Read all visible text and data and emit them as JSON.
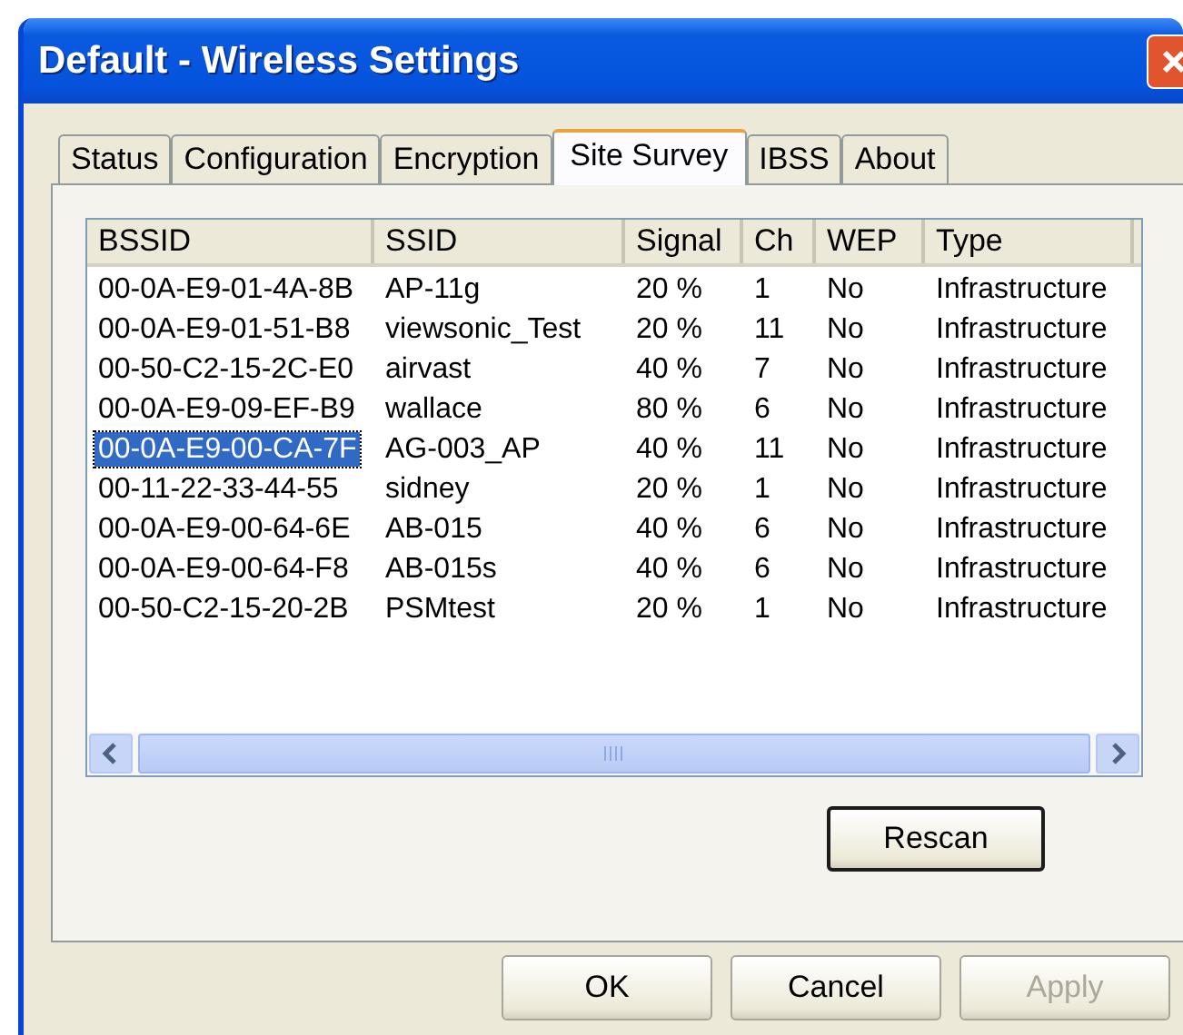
{
  "window": {
    "title": "Default - Wireless Settings"
  },
  "tabs": [
    {
      "label": "Status",
      "selected": false
    },
    {
      "label": "Configuration",
      "selected": false
    },
    {
      "label": "Encryption",
      "selected": false
    },
    {
      "label": "Site Survey",
      "selected": true
    },
    {
      "label": "IBSS",
      "selected": false
    },
    {
      "label": "About",
      "selected": false
    }
  ],
  "table": {
    "columns": [
      "BSSID",
      "SSID",
      "Signal",
      "Ch",
      "WEP",
      "Type"
    ],
    "rows": [
      {
        "cells": [
          "00-0A-E9-01-4A-8B",
          "AP-11g",
          "20 %",
          "1",
          "No",
          "Infrastructure"
        ],
        "selected": false
      },
      {
        "cells": [
          "00-0A-E9-01-51-B8",
          "viewsonic_Test",
          "20 %",
          "11",
          "No",
          "Infrastructure"
        ],
        "selected": false
      },
      {
        "cells": [
          "00-50-C2-15-2C-E0",
          "airvast",
          "40 %",
          "7",
          "No",
          "Infrastructure"
        ],
        "selected": false
      },
      {
        "cells": [
          "00-0A-E9-09-EF-B9",
          "wallace",
          "80 %",
          "6",
          "No",
          "Infrastructure"
        ],
        "selected": false
      },
      {
        "cells": [
          "00-0A-E9-00-CA-7F",
          "AG-003_AP",
          "40 %",
          "11",
          "No",
          "Infrastructure"
        ],
        "selected": true
      },
      {
        "cells": [
          "00-11-22-33-44-55",
          "sidney",
          "20 %",
          "1",
          "No",
          "Infrastructure"
        ],
        "selected": false
      },
      {
        "cells": [
          "00-0A-E9-00-64-6E",
          "AB-015",
          "40 %",
          "6",
          "No",
          "Infrastructure"
        ],
        "selected": false
      },
      {
        "cells": [
          "00-0A-E9-00-64-F8",
          "AB-015s",
          "40 %",
          "6",
          "No",
          "Infrastructure"
        ],
        "selected": false
      },
      {
        "cells": [
          "00-50-C2-15-20-2B",
          "PSMtest",
          "20 %",
          "1",
          "No",
          "Infrastructure"
        ],
        "selected": false
      }
    ]
  },
  "rescan_button": "Rescan",
  "buttons": [
    {
      "label": "OK",
      "disabled": false
    },
    {
      "label": "Cancel",
      "disabled": false
    },
    {
      "label": "Apply",
      "disabled": true
    }
  ]
}
